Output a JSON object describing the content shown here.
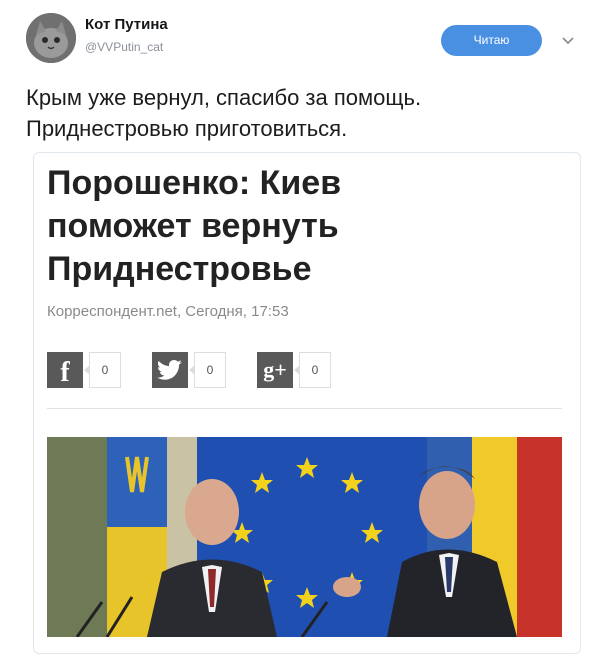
{
  "tweet": {
    "author_name": "Кот Путина",
    "author_handle": "@VVPutin_cat",
    "follow_label": "Читаю",
    "text_lines": [
      "Крым уже вернул, спасибо за помощь.",
      "Приднестровью приготовиться."
    ]
  },
  "card": {
    "headline_lines": [
      "Порошенко: Киев",
      "поможет вернуть",
      "Приднестровье"
    ],
    "source": "Корреспондент.net, Сегодня, 17:53",
    "share": [
      {
        "network": "facebook",
        "icon": "facebook-icon",
        "glyph": "f",
        "count": "0"
      },
      {
        "network": "twitter",
        "icon": "twitter-bird-icon",
        "glyph": "",
        "count": "0"
      },
      {
        "network": "google-plus",
        "icon": "google-plus-icon",
        "glyph": "g+",
        "count": "0"
      }
    ]
  },
  "colors": {
    "follow_button": "#4a90e2",
    "eu_blue": "#1f4fb0",
    "eu_star": "#f3d21c",
    "share_icon_bg": "#595959"
  }
}
